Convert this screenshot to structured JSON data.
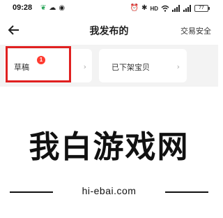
{
  "status_bar": {
    "time": "09:28",
    "left_icons": [
      "leaf-icon",
      "cloud-icon",
      "weibo-icon"
    ],
    "right_icons": [
      "alarm-icon",
      "nfc-icon",
      "hd-icon",
      "wifi-icon",
      "signal-icon",
      "signal-icon"
    ],
    "hd_label": "HD",
    "battery": "77"
  },
  "nav": {
    "title": "我发布的",
    "right_label": "交易安全",
    "back_icon": "arrow-left-icon"
  },
  "tabs": [
    {
      "label": "草稿",
      "badge": "1",
      "chevron": "›"
    },
    {
      "label": "已下架宝贝",
      "chevron": "›"
    }
  ],
  "watermark": {
    "text": "我白游戏网",
    "url": "hi-ebai.com"
  },
  "colors": {
    "highlight": "#e02020",
    "badge": "#ff3b30",
    "tabs_background": "#f3f3f3"
  }
}
